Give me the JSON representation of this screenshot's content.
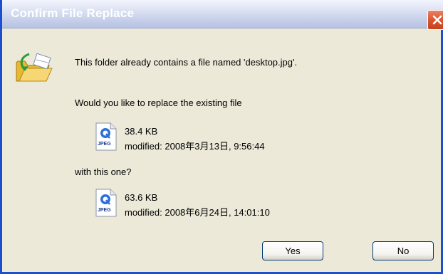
{
  "dialog": {
    "title": "Confirm File Replace",
    "message": "This folder already contains a file named 'desktop.jpg'.",
    "question": "Would you like to replace the existing file",
    "with_text": "with this one?"
  },
  "existing_file": {
    "size": "38.4 KB",
    "modified": "modified: 2008年3月13日, 9:56:44",
    "icon_label": "JPEG"
  },
  "new_file": {
    "size": "63.6 KB",
    "modified": "modified: 2008年6月24日, 14:01:10",
    "icon_label": "JPEG"
  },
  "buttons": {
    "yes": "Yes",
    "no": "No"
  },
  "icons": {
    "folder": "folder-icon",
    "file": "jpeg-file-icon",
    "close": "close-icon"
  },
  "colors": {
    "window_border": "#1c4fd0",
    "close_button": "#d9522c",
    "dialog_background": "#ece9d8"
  }
}
